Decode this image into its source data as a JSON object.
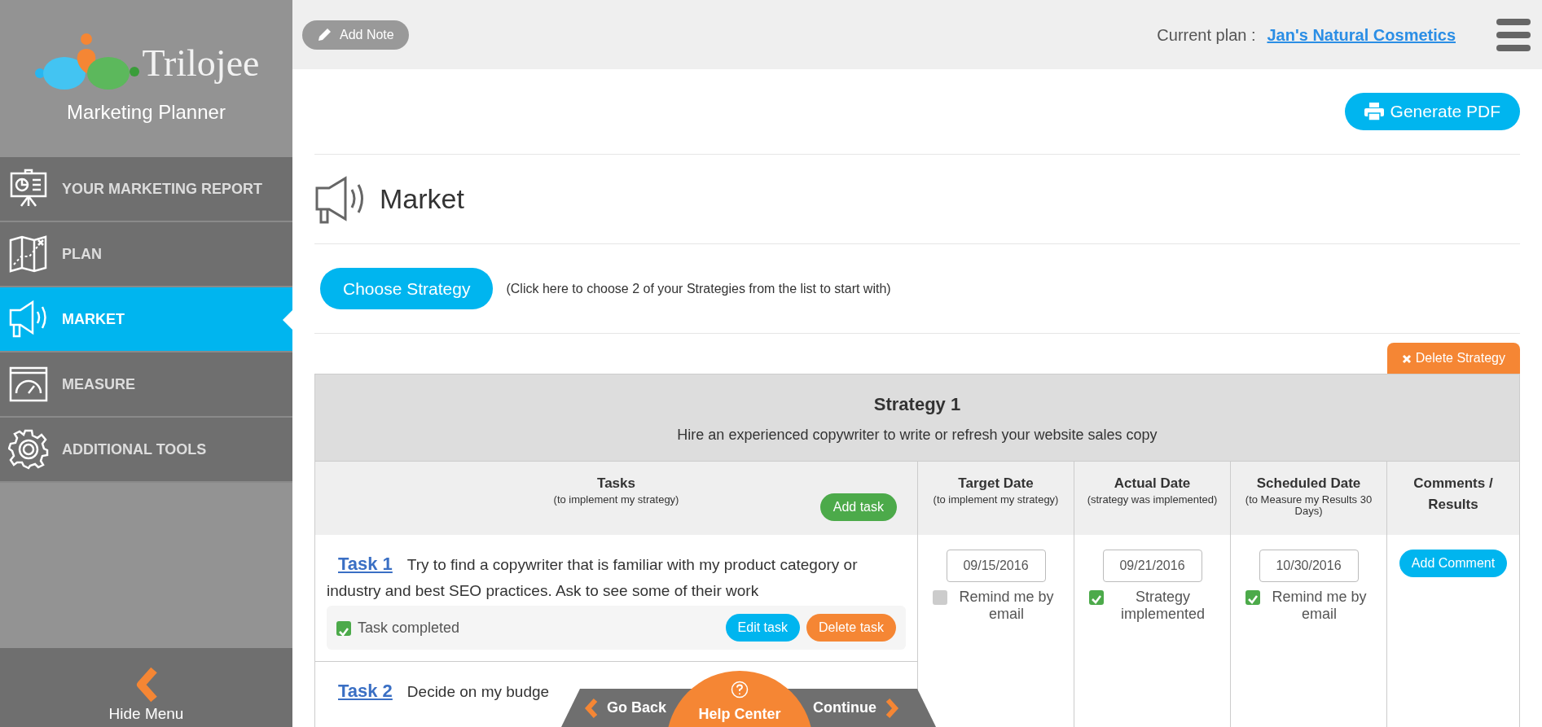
{
  "sidebar": {
    "logo_text": "Trilojee",
    "subtitle": "Marketing Planner",
    "items": [
      {
        "label": "YOUR MARKETING REPORT",
        "kind": "report",
        "selected": false
      },
      {
        "label": "PLAN",
        "kind": "map",
        "selected": false
      },
      {
        "label": "MARKET",
        "kind": "megaphone",
        "selected": true
      },
      {
        "label": "MEASURE",
        "kind": "gauge",
        "selected": false
      },
      {
        "label": "ADDITIONAL TOOLS",
        "kind": "gear",
        "selected": false
      }
    ],
    "hide_menu": "Hide Menu"
  },
  "header": {
    "add_note": "Add Note",
    "plan_label": "Current plan :",
    "plan_name": "Jan's Natural Cosmetics"
  },
  "page": {
    "generate_pdf": "Generate PDF",
    "title": "Market",
    "choose_strategy": "Choose Strategy",
    "hint": "(Click here to choose 2 of your Strategies from the list to start with)"
  },
  "strategy": {
    "delete": "Delete Strategy",
    "title": "Strategy 1",
    "description": "Hire an experienced copywriter to write or refresh your website sales copy",
    "columns": [
      {
        "title": "Tasks",
        "subtitle": "(to implement my strategy)"
      },
      {
        "title": "Target Date",
        "subtitle": "(to implement my strategy)"
      },
      {
        "title": "Actual Date",
        "subtitle": "(strategy was implemented)"
      },
      {
        "title": "Scheduled Date",
        "subtitle": "(to Measure my Results 30 Days)"
      },
      {
        "title": "Comments / Results"
      }
    ],
    "add_task": "Add task",
    "tasks": [
      {
        "label": "Task 1",
        "text": "Try to find a copywriter that is familiar with my product category or industry and best SEO practices. Ask to see some of their work",
        "completed_label": "Task completed",
        "completed": true,
        "edit": "Edit task",
        "delete": "Delete task"
      },
      {
        "label": "Task 2",
        "text": "Decide on my budge"
      }
    ],
    "dates": [
      {
        "value": "09/15/2016",
        "option": "Remind me by email",
        "checked": false
      },
      {
        "value": "09/21/2016",
        "option": "Strategy implemented",
        "checked": true
      },
      {
        "value": "10/30/2016",
        "option": "Remind me by email",
        "checked": true
      }
    ],
    "add_comment": "Add Comment"
  },
  "bottom_nav": {
    "go_back": "Go Back",
    "help_center": "Help Center",
    "continue": "Continue"
  }
}
